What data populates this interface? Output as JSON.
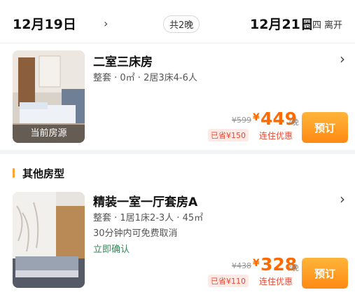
{
  "header": {
    "checkin_date": "12月19日",
    "nights": "共2晚",
    "checkout_date": "12月21日",
    "checkout_weekday": "周四",
    "checkout_label": "离开"
  },
  "current_room": {
    "title": "二室三床房",
    "desc": "整套 · 0㎡ · 2居3床4-6人",
    "thumb_label": "当前房源",
    "original_price": "¥599",
    "price_symbol": "¥",
    "price": "449",
    "price_unit": "/晚",
    "saved": "已省¥150",
    "promo": "连住优惠",
    "book_label": "预订"
  },
  "other_section": {
    "title": "其他房型"
  },
  "other_room": {
    "title": "精装一室一厅套房A",
    "desc": "整套 · 1居1床2-3人 · 45㎡",
    "cancel_note": "30分钟内可免费取消",
    "confirm": "立即确认",
    "original_price": "¥438",
    "price_symbol": "¥",
    "price": "328",
    "price_unit": "/晚",
    "saved": "已省¥110",
    "promo": "连住优惠",
    "book_label": "预订"
  },
  "colors": {
    "accent_orange": "#ff6a00",
    "button_orange": "#ff8a13",
    "promo_red": "#e94b35",
    "confirm_green": "#2e8b57",
    "section_bar": "#ffa235"
  }
}
